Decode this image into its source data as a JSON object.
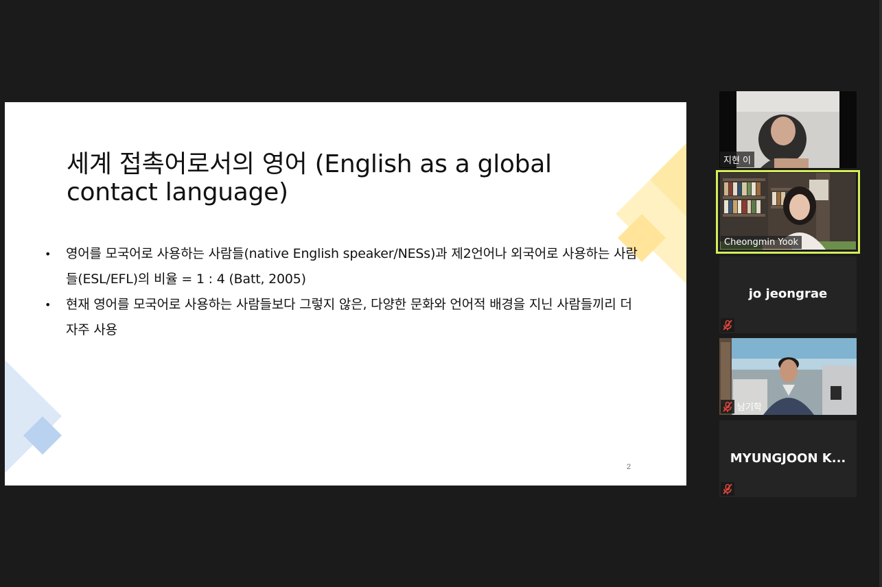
{
  "slide": {
    "title": "세계 접촉어로서의 영어 (English as a global contact language)",
    "bullets": [
      {
        "marker": "•",
        "text": "영어를 모국어로 사용하는 사람들(native English speaker/NESs)과 제2언어나 외국어로 사용하는 사람들(ESL/EFL)의 비율 = 1 : 4 (Batt, 2005)"
      },
      {
        "marker": "•",
        "text": "현재 영어를 모국어로 사용하는 사람들보다 그렇지 않은, 다양한 문화와 언어적 배경을 지닌 사람들끼리 더 자주 사용"
      }
    ],
    "page_number": "2",
    "colors": {
      "accent_yellow": "#ffe9a6",
      "accent_blue": "#c9dcf3"
    }
  },
  "participants": [
    {
      "name": "지현 이",
      "video": true,
      "muted": false,
      "active_speaker": false
    },
    {
      "name": "Cheongmin Yook",
      "video": true,
      "muted": false,
      "active_speaker": true
    },
    {
      "name": "jo jeongrae",
      "video": false,
      "muted": true,
      "active_speaker": false
    },
    {
      "name": "남기학",
      "video": true,
      "muted": true,
      "active_speaker": false
    },
    {
      "name": "MYUNGJOON K...",
      "video": false,
      "muted": true,
      "active_speaker": false
    }
  ],
  "colors": {
    "background": "#1b1b1b",
    "active_speaker_border": "#d6ee5a",
    "mute_icon": "#e0463b"
  },
  "icons": {
    "muted": "mic-muted-icon"
  }
}
